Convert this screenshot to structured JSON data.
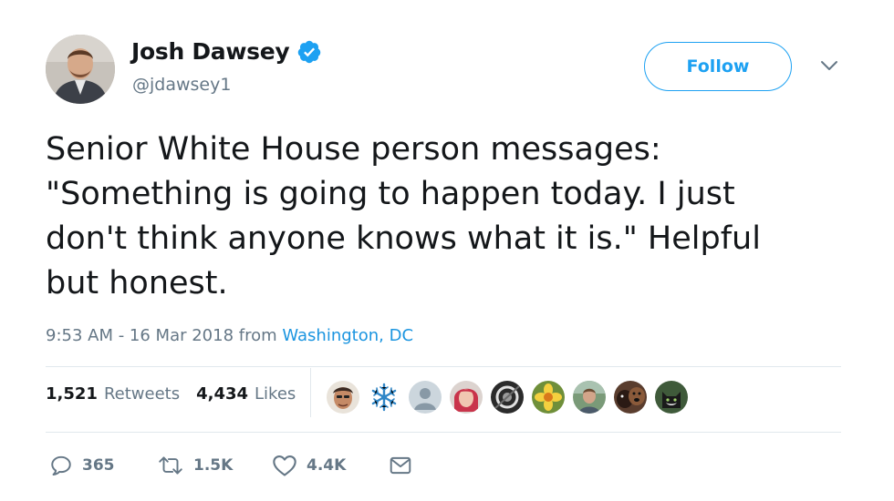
{
  "author": {
    "name": "Josh Dawsey",
    "handle": "@jdawsey1",
    "verified": true
  },
  "follow_button": {
    "label": "Follow"
  },
  "tweet": {
    "lines": [
      "Senior White House person messages:",
      "\"Something is going to happen today. I just",
      "don't think anyone knows what it is.\" Helpful",
      "but honest."
    ],
    "timestamp": "9:53 AM - 16 Mar 2018 from ",
    "location": "Washington, DC"
  },
  "stats": {
    "retweets": {
      "count": "1,521",
      "label": "Retweets"
    },
    "likes": {
      "count": "4,434",
      "label": "Likes"
    }
  },
  "liked_by_avatars": [
    "man-face-avatar",
    "snowflake-avatar",
    "default-avatar",
    "red-hair-avatar",
    "bw-circle-avatar",
    "flower-avatar",
    "outdoor-person-avatar",
    "dogs-avatar",
    "cat-avatar"
  ],
  "actions": {
    "reply": {
      "icon": "reply-icon",
      "count": "365"
    },
    "retweet": {
      "icon": "retweet-icon",
      "count": "1.5K"
    },
    "like": {
      "icon": "heart-icon",
      "count": "4.4K"
    },
    "message": {
      "icon": "envelope-icon"
    }
  },
  "colors": {
    "accent": "#1da1f2",
    "link": "#1b95e0",
    "secondary_text": "#657786",
    "primary_text": "#14171a",
    "divider": "#e1e8ed"
  }
}
